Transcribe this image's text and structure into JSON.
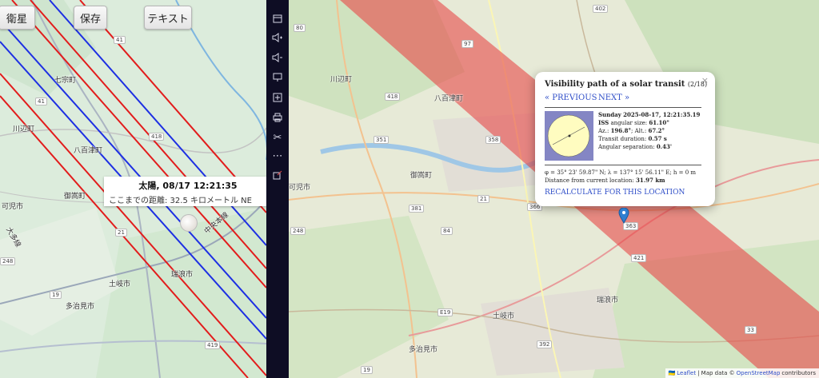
{
  "left_panel": {
    "buttons": {
      "satellite": "衛星",
      "save": "保存",
      "text": "テキスト"
    },
    "labels": {
      "nanamune": "七宗町",
      "kawabe": "川辺町",
      "yaotsu": "八百津町",
      "mitake": "御嵩町",
      "kani": "可児市",
      "toki": "土岐市",
      "mizunami": "瑞浪市",
      "tajimi": "多治見市",
      "tajima_prefix": "大多線",
      "chuo": "中央本線"
    },
    "road_numbers": [
      "41",
      "41",
      "418",
      "21",
      "19",
      "248",
      "419"
    ],
    "sun_tooltip": {
      "title": "太陽, 08/17 12:21:35",
      "distance": "ここまでの距離: 32.5 キロメートル  NE"
    }
  },
  "toolbar": {
    "icons": [
      "calendar-icon",
      "volume-up-icon",
      "volume-down-icon",
      "display-icon",
      "new-tab-icon",
      "print-icon",
      "scissors-icon",
      "more-icon",
      "share-icon"
    ]
  },
  "right_map": {
    "labels": {
      "kawabe": "川辺町",
      "yaotsu": "八百津町",
      "mitake": "御嵩町",
      "kani": "可児市",
      "toki": "土岐市",
      "mizunami": "瑞浪市",
      "tajimi": "多治見市"
    },
    "road_numbers": [
      "402",
      "80",
      "97",
      "418",
      "351",
      "358",
      "381",
      "366",
      "21",
      "84",
      "248",
      "421",
      "E19",
      "392",
      "33",
      "19",
      "363"
    ],
    "popup": {
      "close": "×",
      "title": "Visibility path of a solar transit",
      "counter": "(2/18)",
      "prev": "« PREVIOUS",
      "next": "NEXT »",
      "date": "Sunday 2025-08-17, 12:21:35.19",
      "iss_label": "ISS",
      "angular_size_label": " angular size: ",
      "angular_size": "61.10\"",
      "az_label": "Az.: ",
      "az": "196.8°",
      "alt_label": "; Alt.: ",
      "alt": "67.2°",
      "transit_label": "Transit duration: ",
      "transit": "0.57 s",
      "sep_label": "Angular separation: ",
      "sep": "0.43'",
      "coords": "φ = 35° 23' 59.87\" N; λ = 137° 15' 56.11\" E; h = 0 m",
      "distance_label": "Distance from current location: ",
      "distance": "31.97 km",
      "recalc": "RECALCULATE FOR THIS LOCATION"
    },
    "attribution": {
      "flag": "🇺🇦",
      "leaflet": "Leaflet",
      "sep": " | Map data © ",
      "osm": "OpenStreetMap",
      "contributors": " contributors"
    }
  }
}
